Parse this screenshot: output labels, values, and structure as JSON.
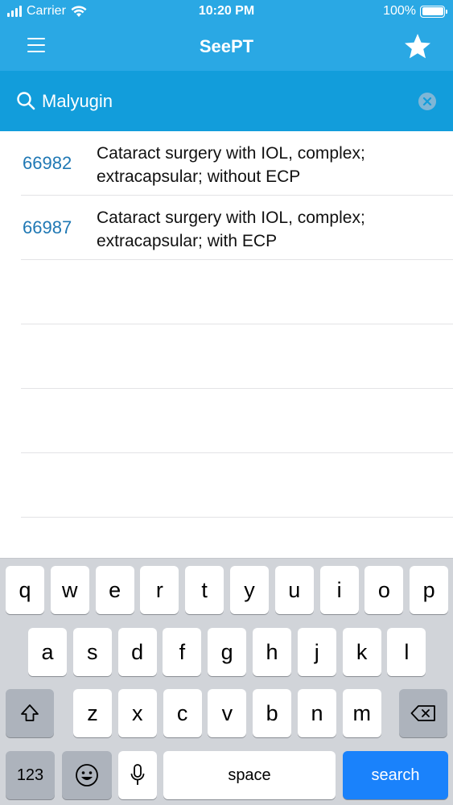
{
  "status_bar": {
    "carrier": "Carrier",
    "time": "10:20 PM",
    "battery": "100%",
    "battery_level": 1.0
  },
  "nav": {
    "title": "SeePT",
    "menu_icon": "hamburger-menu-icon",
    "favorite_icon": "star-icon"
  },
  "search": {
    "value": "Malyugin",
    "placeholder": "",
    "search_icon": "magnifier-icon",
    "clear_icon": "clear-circle-icon"
  },
  "results": [
    {
      "code": "66982",
      "description": "Cataract surgery with IOL, complex; extracapsular; without ECP"
    },
    {
      "code": "66987",
      "description": "Cataract surgery with IOL, complex; extracapsular; with ECP"
    }
  ],
  "keyboard": {
    "row1": [
      "q",
      "w",
      "e",
      "r",
      "t",
      "y",
      "u",
      "i",
      "o",
      "p"
    ],
    "row2": [
      "a",
      "s",
      "d",
      "f",
      "g",
      "h",
      "j",
      "k",
      "l"
    ],
    "row3": [
      "z",
      "x",
      "c",
      "v",
      "b",
      "n",
      "m"
    ],
    "shift_icon": "shift-arrow-icon",
    "delete_icon": "backspace-icon",
    "numbers_label": "123",
    "emoji_icon": "emoji-icon",
    "mic_icon": "microphone-icon",
    "space_label": "space",
    "search_label": "search"
  },
  "colors": {
    "nav_background": "#2aa8e4",
    "search_background": "#129ddb",
    "code_text": "#1f78b4",
    "search_key": "#1a82fb"
  }
}
